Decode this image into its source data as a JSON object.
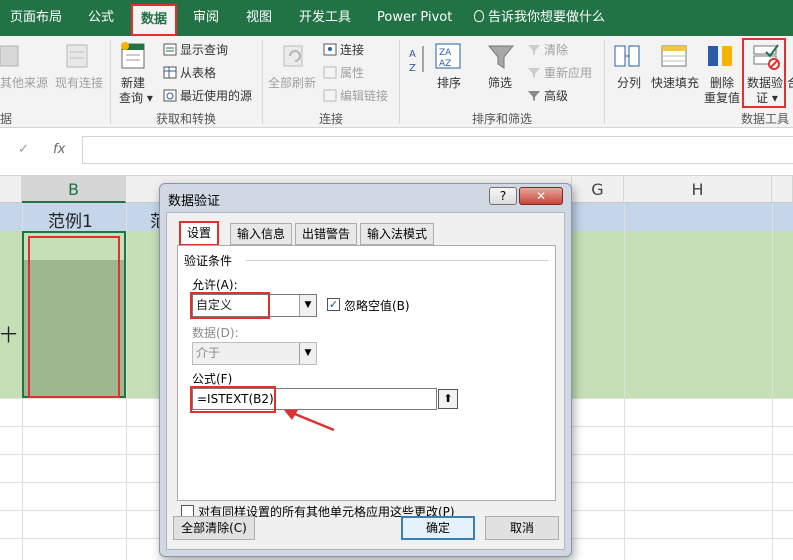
{
  "ribbon_tabs": {
    "page_layout": "页面布局",
    "formulas": "公式",
    "data": "数据",
    "review": "审阅",
    "view": "视图",
    "developer": "开发工具",
    "power_pivot": "Power Pivot",
    "tell_me": "告诉我你想要做什么"
  },
  "ribbon": {
    "other_sources": "其他来源",
    "existing_connections": "现有连接",
    "new_query_line1": "新建",
    "new_query_line2": "查询",
    "show_queries": "显示查询",
    "from_table": "从表格",
    "recent_sources": "最近使用的源",
    "refresh_all": "全部刷新",
    "connections": "连接",
    "properties": "属性",
    "edit_links": "编辑链接",
    "sort": "排序",
    "filter": "筛选",
    "clear": "清除",
    "reapply": "重新应用",
    "advanced": "高级",
    "text_to_columns": "分列",
    "flash_fill": "快速填充",
    "remove_dup_line1": "删除",
    "remove_dup_line2": "重复值",
    "data_validation_line1": "数据验",
    "data_validation_line2": "证",
    "group_get_transform": "获取和转换",
    "group_connections": "连接",
    "group_sort_filter": "排序和筛选",
    "group_data_tools": "数据工具",
    "group_left_fragment": "据",
    "right_fragment": "合"
  },
  "formula_bar": {
    "check": "✓",
    "fx": "fx",
    "value": ""
  },
  "sheet": {
    "col_b": "B",
    "col_g": "G",
    "col_h": "H",
    "cell_b2": "范例1",
    "cell_c2_fragment": "范",
    "left_fragment": "十"
  },
  "dialog": {
    "title": "数据验证",
    "help": "?",
    "close": "✕",
    "tabs": {
      "settings": "设置",
      "input_message": "输入信息",
      "error_alert": "出错警告",
      "ime_mode": "输入法模式"
    },
    "criteria_heading": "验证条件",
    "allow_label": "允许(A):",
    "allow_value": "自定义",
    "ignore_blank_label": "忽略空值(B)",
    "ignore_blank_checked": true,
    "data_label": "数据(D):",
    "data_value": "介于",
    "formula_label": "公式(F)",
    "formula_value": "=ISTEXT(B2)",
    "apply_all_label": "对有同样设置的所有其他单元格应用这些更改(P)",
    "apply_all_checked": false,
    "clear_all_button": "全部清除(C)",
    "ok_button": "确定",
    "cancel_button": "取消"
  },
  "colors": {
    "excel_green": "#217346",
    "highlight_red": "#e03030",
    "band_green": "#c6dfb6",
    "header_blue": "#c5d5ea"
  }
}
